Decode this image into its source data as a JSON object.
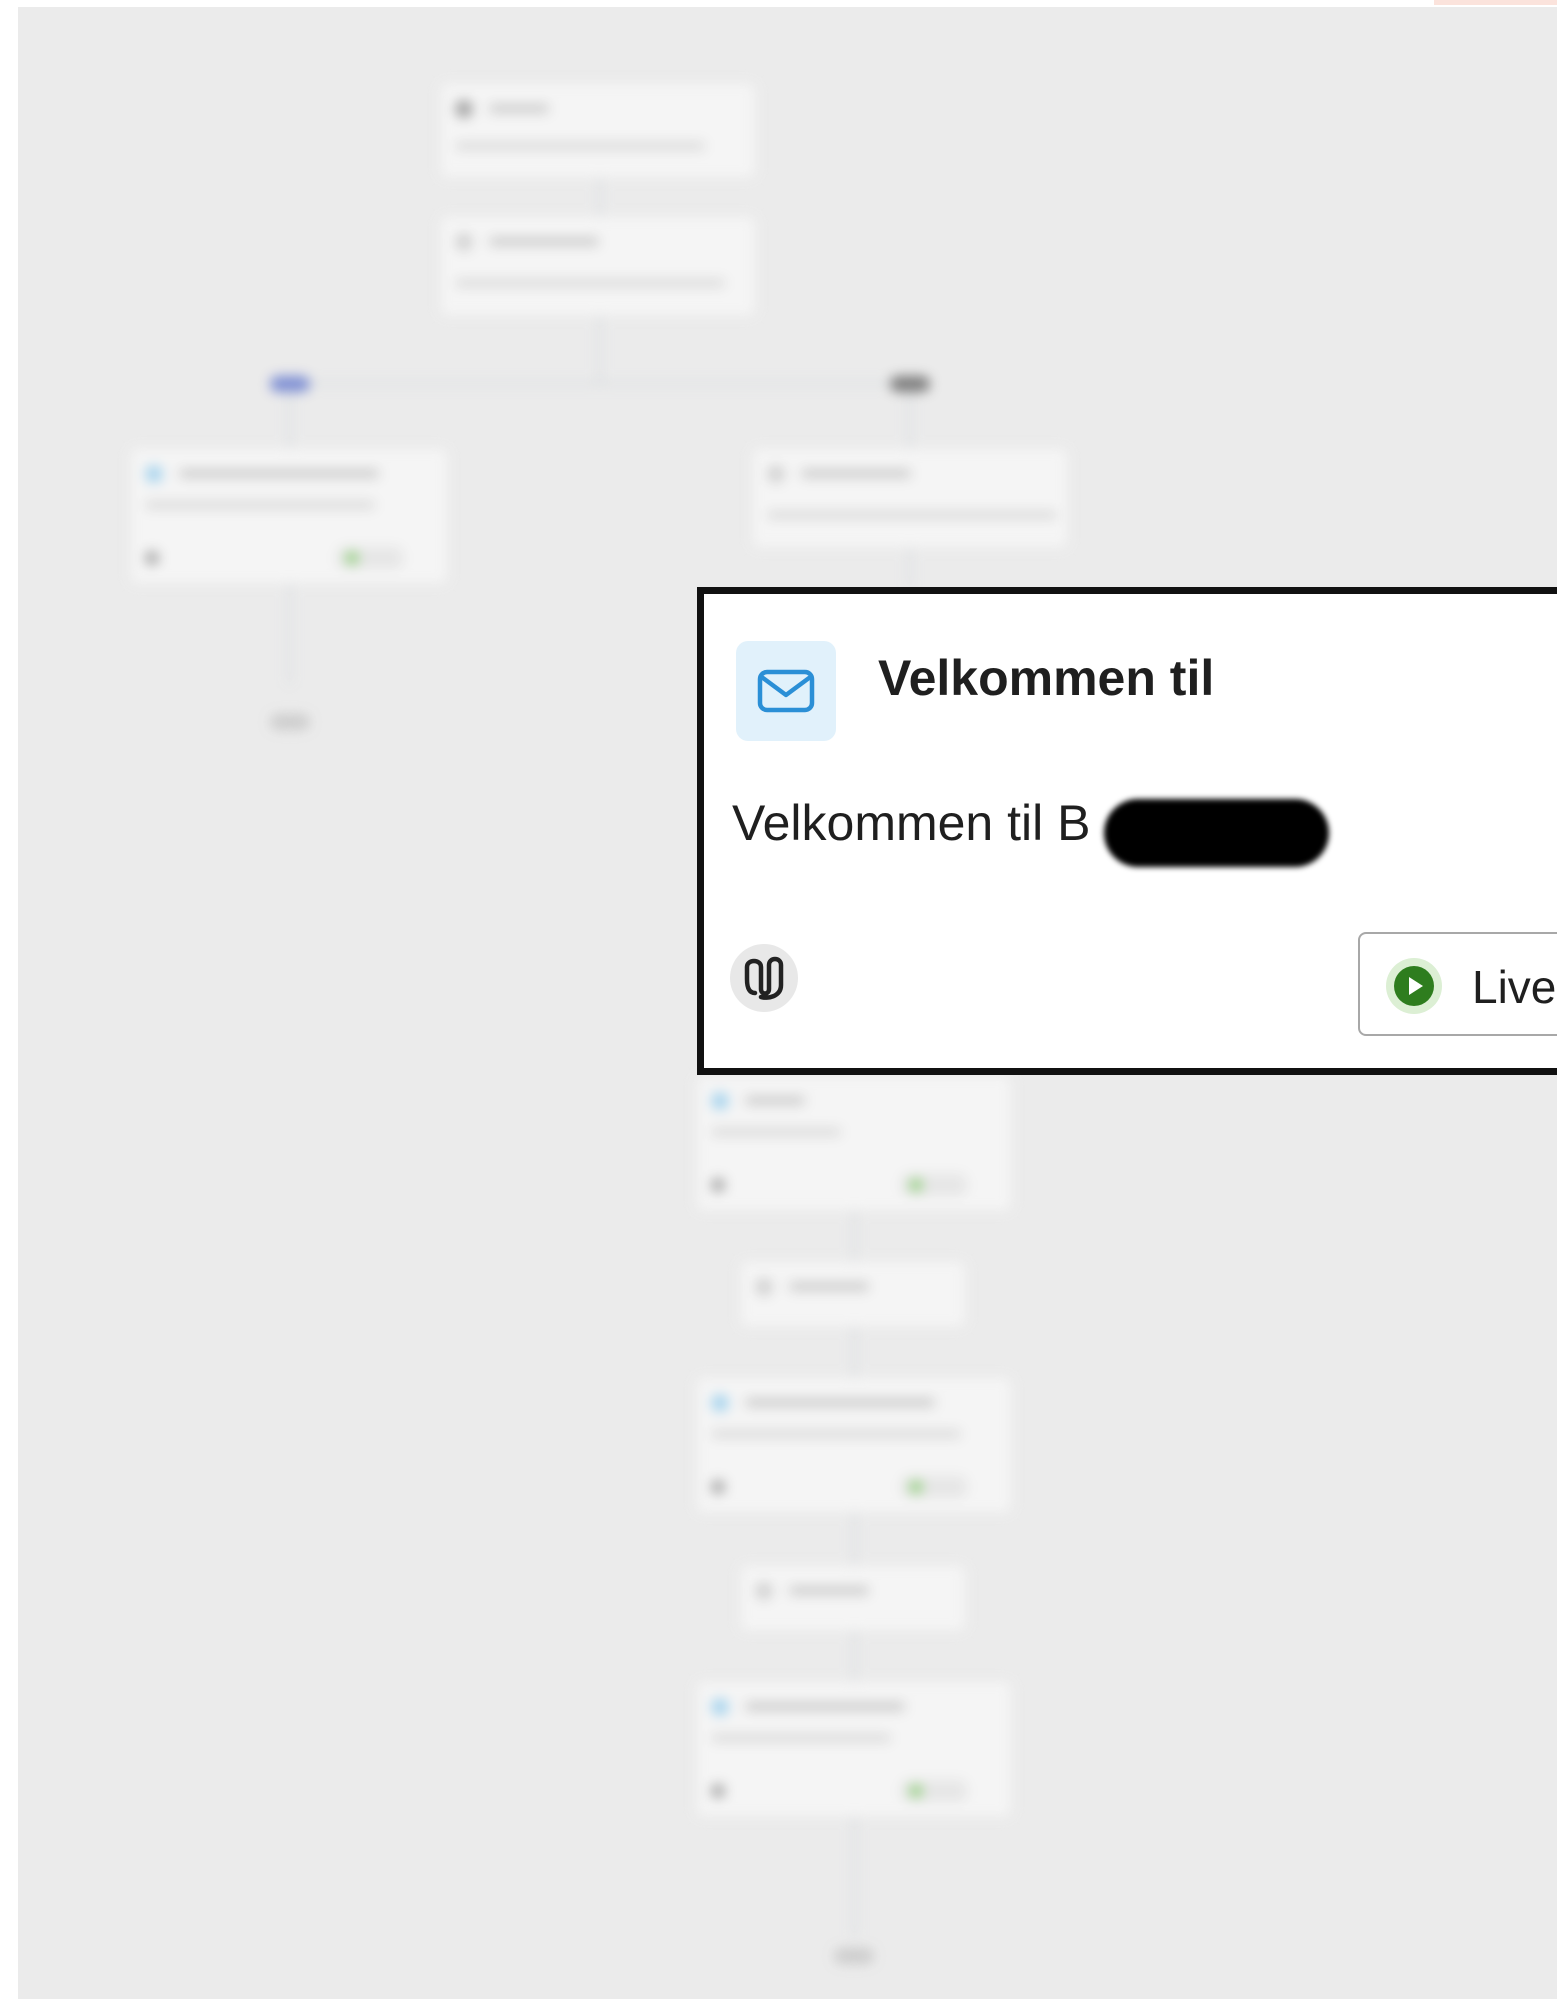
{
  "card": {
    "title": "Velkommen til",
    "description": "Velkommen til B",
    "status_label": "Live",
    "icon": "mail-icon",
    "attachment_icon": "paperclip-icon",
    "status_icon": "play-circle-icon"
  },
  "colors": {
    "canvas": "#ebebeb",
    "icon_bg": "#e1f1fb",
    "icon_stroke": "#2b8fd6",
    "live_green": "#2e7d1e",
    "live_bg": "#dcefd4",
    "card_border": "#111111"
  }
}
